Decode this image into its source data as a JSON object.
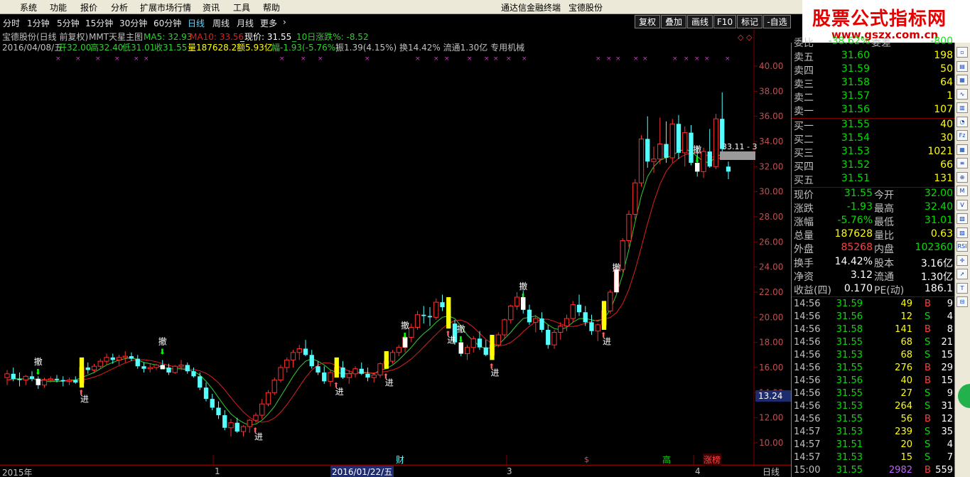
{
  "menubar": {
    "items": [
      "系统",
      "功能",
      "报价",
      "分析",
      "扩展市场行情",
      "资讯",
      "工具",
      "帮助"
    ],
    "app_title": "通达信金融终端",
    "stock_title": "宝德股份"
  },
  "periodbar": {
    "items": [
      "分时",
      "1分钟",
      "5分钟",
      "15分钟",
      "30分钟",
      "60分钟",
      "日线",
      "周线",
      "月线",
      "更多"
    ],
    "active": "日线",
    "more_arrow": "›"
  },
  "toolbar": {
    "buttons": [
      "复权",
      "叠加",
      "画线",
      "F10",
      "标记",
      "-自选"
    ]
  },
  "chart_header": {
    "line1_title": "宝德股份(日线 前复权)",
    "line1_formula": "MMT天星主图",
    "ma5_label": "MA5: 32.93",
    "ma10_label": "MA10: 33.56",
    "price_label": "_现价: 31.55",
    "chg10_label": "_10日涨跌%: -8.52",
    "line2_date": "2016/04/08/五",
    "line2_open": "开32.00",
    "line2_high": "高32.40",
    "line2_low": "低31.01",
    "line2_close": "收31.55",
    "line2_vol": "量187628.2",
    "line2_amount": "额5.93亿",
    "line2_chg": "幅-1.93(-5.76%)",
    "line2_rest": "振1.39(4.15%) 换14.42% 流通1.30亿 专用机械"
  },
  "y_axis": [
    "40.00",
    "38.00",
    "36.00",
    "34.00",
    "32.00",
    "30.00",
    "28.00",
    "26.00",
    "24.00",
    "22.00",
    "20.00",
    "18.00",
    "16.00",
    "14.00",
    "12.00",
    "10.00"
  ],
  "price_tag": "13.24",
  "price_tag_right": "33.11 - 3",
  "signal_labels": {
    "sell": "撤",
    "buy": "进"
  },
  "bottom_bar": {
    "year": "2015年",
    "m1": "1",
    "date_box": "2016/01/22/五",
    "m3": "3",
    "m4": "4",
    "cai": "财",
    "dollar": "$",
    "gao": "高",
    "zhangbang": "涨榜",
    "period": "日线"
  },
  "watermark": {
    "title": "股票公式指标网",
    "url": "www.gszx.com.cn"
  },
  "panel": {
    "weibi_label": "委比",
    "weibi_val": "-38.62%",
    "weicha_label": "委差",
    "weicha_val": "-800",
    "sells": [
      {
        "label": "卖五",
        "price": "31.60",
        "vol": "198"
      },
      {
        "label": "卖四",
        "price": "31.59",
        "vol": "50"
      },
      {
        "label": "卖三",
        "price": "31.58",
        "vol": "64"
      },
      {
        "label": "卖二",
        "price": "31.57",
        "vol": "1"
      },
      {
        "label": "卖一",
        "price": "31.56",
        "vol": "107"
      }
    ],
    "buys": [
      {
        "label": "买一",
        "price": "31.55",
        "vol": "40"
      },
      {
        "label": "买二",
        "price": "31.54",
        "vol": "30"
      },
      {
        "label": "买三",
        "price": "31.53",
        "vol": "1021"
      },
      {
        "label": "买四",
        "price": "31.52",
        "vol": "66"
      },
      {
        "label": "买五",
        "price": "31.51",
        "vol": "131"
      }
    ],
    "stats": [
      {
        "l1": "现价",
        "v1": "31.55",
        "c1": "green",
        "l2": "今开",
        "v2": "32.00",
        "c2": "green"
      },
      {
        "l1": "涨跌",
        "v1": "-1.93",
        "c1": "green",
        "l2": "最高",
        "v2": "32.40",
        "c2": "green"
      },
      {
        "l1": "涨幅",
        "v1": "-5.76%",
        "c1": "green",
        "l2": "最低",
        "v2": "31.01",
        "c2": "green"
      },
      {
        "l1": "总量",
        "v1": "187628",
        "c1": "yellow",
        "l2": "量比",
        "v2": "0.63",
        "c2": "yellow"
      },
      {
        "l1": "外盘",
        "v1": "85268",
        "c1": "red",
        "l2": "内盘",
        "v2": "102360",
        "c2": "green"
      },
      {
        "l1": "换手",
        "v1": "14.42%",
        "c1": "white",
        "l2": "股本",
        "v2": "3.16亿",
        "c2": "white"
      },
      {
        "l1": "净资",
        "v1": "3.12",
        "c1": "white",
        "l2": "流通",
        "v2": "1.30亿",
        "c2": "white"
      },
      {
        "l1": "收益(四)",
        "v1": "0.170",
        "c1": "white",
        "l2": "PE(动)",
        "v2": "186.1",
        "c2": "white"
      }
    ],
    "ticks": [
      {
        "t": "14:56",
        "p": "31.59",
        "v": "49",
        "bs": "B",
        "n": "9"
      },
      {
        "t": "14:56",
        "p": "31.56",
        "v": "12",
        "bs": "S",
        "n": "4"
      },
      {
        "t": "14:56",
        "p": "31.58",
        "v": "141",
        "bs": "B",
        "n": "8"
      },
      {
        "t": "14:56",
        "p": "31.55",
        "v": "68",
        "bs": "S",
        "n": "21"
      },
      {
        "t": "14:56",
        "p": "31.53",
        "v": "68",
        "bs": "S",
        "n": "15"
      },
      {
        "t": "14:56",
        "p": "31.55",
        "v": "276",
        "bs": "B",
        "n": "29"
      },
      {
        "t": "14:56",
        "p": "31.56",
        "v": "40",
        "bs": "B",
        "n": "15"
      },
      {
        "t": "14:56",
        "p": "31.55",
        "v": "27",
        "bs": "S",
        "n": "9"
      },
      {
        "t": "14:56",
        "p": "31.53",
        "v": "264",
        "bs": "S",
        "n": "31"
      },
      {
        "t": "14:56",
        "p": "31.55",
        "v": "56",
        "bs": "B",
        "n": "12"
      },
      {
        "t": "14:57",
        "p": "31.53",
        "v": "239",
        "bs": "S",
        "n": "35"
      },
      {
        "t": "14:57",
        "p": "31.51",
        "v": "20",
        "bs": "S",
        "n": "4"
      },
      {
        "t": "14:57",
        "p": "31.53",
        "v": "15",
        "bs": "S",
        "n": "7"
      },
      {
        "t": "15:00",
        "p": "31.55",
        "v": "2982",
        "bs": "B",
        "n": "559"
      }
    ]
  },
  "colors": {
    "up": "#ff3030",
    "down": "#54ffff",
    "ma5": "#32cd32",
    "ma10": "#dc2020",
    "signal_yellow": "#ffff00",
    "axis_red": "#800000"
  },
  "chart_data": {
    "type": "candlestick",
    "ylim": [
      10,
      40
    ],
    "ohlc": [
      [
        15.2,
        15.8,
        14.6,
        15.5
      ],
      [
        15.5,
        16.0,
        14.9,
        15.1
      ],
      [
        15.1,
        15.6,
        14.5,
        15.0
      ],
      [
        15.0,
        15.4,
        14.6,
        15.3
      ],
      [
        15.3,
        15.7,
        14.9,
        15.1
      ],
      [
        15.1,
        15.3,
        14.3,
        14.6
      ],
      [
        14.6,
        15.2,
        14.4,
        15.0
      ],
      [
        15.0,
        15.3,
        14.8,
        15.1
      ],
      [
        15.1,
        15.4,
        14.8,
        15.0
      ],
      [
        15.0,
        15.3,
        14.5,
        14.9
      ],
      [
        14.9,
        15.2,
        14.6,
        15.0
      ],
      [
        15.0,
        15.3,
        14.7,
        14.8
      ],
      [
        14.8,
        16.2,
        14.6,
        16.0
      ],
      [
        16.0,
        16.4,
        15.5,
        15.8
      ],
      [
        15.8,
        16.3,
        15.6,
        16.1
      ],
      [
        16.1,
        16.7,
        15.9,
        16.5
      ],
      [
        16.5,
        17.1,
        16.2,
        16.8
      ],
      [
        16.8,
        17.1,
        16.3,
        16.6
      ],
      [
        16.6,
        17.0,
        16.2,
        16.8
      ],
      [
        16.8,
        17.3,
        16.4,
        16.9
      ],
      [
        16.9,
        17.2,
        16.5,
        16.7
      ],
      [
        16.7,
        17.0,
        15.9,
        16.1
      ],
      [
        16.1,
        16.4,
        15.6,
        15.9
      ],
      [
        15.9,
        16.3,
        15.6,
        16.0
      ],
      [
        16.0,
        16.3,
        15.8,
        16.2
      ],
      [
        16.2,
        16.6,
        15.9,
        16.0
      ],
      [
        16.0,
        16.3,
        15.4,
        15.6
      ],
      [
        15.6,
        16.2,
        15.5,
        16.1
      ],
      [
        16.1,
        16.6,
        15.8,
        16.2
      ],
      [
        16.2,
        16.4,
        15.5,
        15.7
      ],
      [
        15.7,
        16.0,
        15.2,
        15.3
      ],
      [
        15.3,
        15.6,
        14.2,
        14.4
      ],
      [
        14.4,
        14.8,
        13.3,
        13.5
      ],
      [
        13.5,
        13.9,
        12.6,
        12.8
      ],
      [
        12.8,
        13.3,
        11.9,
        12.2
      ],
      [
        12.2,
        12.6,
        11.0,
        11.2
      ],
      [
        11.2,
        11.9,
        10.5,
        11.6
      ],
      [
        11.6,
        12.0,
        10.8,
        10.9
      ],
      [
        10.9,
        11.4,
        10.5,
        11.3
      ],
      [
        11.3,
        11.9,
        10.8,
        11.8
      ],
      [
        11.8,
        12.4,
        11.6,
        12.2
      ],
      [
        12.2,
        13.5,
        11.9,
        13.1
      ],
      [
        13.1,
        14.2,
        12.9,
        14.0
      ],
      [
        14.0,
        15.2,
        13.8,
        15.0
      ],
      [
        15.0,
        16.2,
        14.8,
        16.0
      ],
      [
        16.0,
        16.8,
        15.6,
        16.6
      ],
      [
        16.6,
        17.4,
        16.0,
        17.2
      ],
      [
        17.2,
        17.8,
        16.6,
        17.5
      ],
      [
        17.5,
        18.2,
        16.9,
        17.0
      ],
      [
        17.0,
        17.4,
        15.9,
        16.1
      ],
      [
        16.1,
        16.5,
        15.4,
        15.6
      ],
      [
        15.6,
        16.1,
        14.7,
        14.9
      ],
      [
        14.9,
        15.8,
        14.5,
        15.6
      ],
      [
        15.6,
        16.1,
        15.2,
        16.0
      ],
      [
        16.0,
        16.5,
        15.1,
        15.2
      ],
      [
        15.2,
        15.8,
        14.7,
        15.5
      ],
      [
        15.5,
        16.1,
        15.2,
        15.9
      ],
      [
        15.9,
        16.4,
        15.4,
        15.5
      ],
      [
        15.5,
        16.0,
        14.9,
        15.2
      ],
      [
        15.2,
        15.6,
        14.8,
        15.4
      ],
      [
        15.4,
        16.4,
        15.2,
        16.3
      ],
      [
        16.3,
        16.8,
        15.9,
        16.5
      ],
      [
        16.5,
        17.4,
        16.3,
        17.2
      ],
      [
        17.2,
        17.8,
        16.9,
        17.6
      ],
      [
        17.6,
        18.5,
        17.2,
        18.4
      ],
      [
        18.4,
        19.5,
        18.0,
        19.2
      ],
      [
        19.2,
        20.5,
        19.0,
        20.2
      ],
      [
        20.2,
        20.9,
        19.5,
        20.1
      ],
      [
        20.1,
        20.8,
        19.3,
        20.0
      ],
      [
        20.0,
        21.5,
        19.8,
        21.2
      ],
      [
        21.2,
        21.8,
        20.5,
        20.8
      ],
      [
        20.8,
        21.1,
        19.3,
        19.5
      ],
      [
        19.5,
        19.8,
        17.8,
        18.0
      ],
      [
        18.0,
        18.5,
        16.9,
        17.1
      ],
      [
        17.1,
        17.8,
        16.6,
        17.6
      ],
      [
        17.6,
        18.5,
        17.2,
        18.3
      ],
      [
        18.3,
        18.9,
        17.4,
        17.6
      ],
      [
        17.6,
        18.2,
        16.9,
        17.0
      ],
      [
        17.0,
        17.9,
        16.7,
        17.8
      ],
      [
        17.8,
        18.8,
        17.6,
        18.6
      ],
      [
        18.6,
        19.9,
        18.3,
        19.8
      ],
      [
        19.8,
        21.0,
        19.5,
        20.9
      ],
      [
        20.9,
        22.0,
        20.6,
        21.6
      ],
      [
        21.6,
        22.1,
        20.3,
        20.6
      ],
      [
        20.6,
        21.0,
        19.4,
        19.6
      ],
      [
        19.6,
        20.2,
        18.8,
        19.9
      ],
      [
        19.9,
        20.4,
        18.8,
        19.0
      ],
      [
        19.0,
        19.4,
        17.5,
        17.8
      ],
      [
        17.8,
        19.0,
        17.5,
        18.8
      ],
      [
        18.8,
        19.6,
        18.2,
        19.3
      ],
      [
        19.3,
        20.2,
        18.9,
        19.9
      ],
      [
        19.9,
        21.3,
        19.6,
        21.0
      ],
      [
        21.0,
        21.8,
        20.1,
        20.4
      ],
      [
        20.4,
        20.9,
        19.3,
        19.6
      ],
      [
        19.6,
        20.2,
        18.6,
        18.9
      ],
      [
        18.9,
        19.5,
        18.1,
        19.4
      ],
      [
        19.4,
        20.6,
        19.2,
        20.5
      ],
      [
        20.5,
        22.2,
        20.3,
        22.0
      ],
      [
        22.0,
        24.1,
        21.8,
        23.8
      ],
      [
        23.8,
        26.3,
        23.6,
        26.1
      ],
      [
        26.1,
        28.5,
        25.6,
        28.2
      ],
      [
        28.2,
        31.0,
        27.8,
        30.7
      ],
      [
        30.7,
        34.5,
        30.4,
        34.2
      ],
      [
        34.2,
        36.0,
        31.9,
        32.4
      ],
      [
        32.4,
        33.6,
        31.5,
        32.6
      ],
      [
        32.6,
        35.9,
        32.2,
        33.8
      ],
      [
        33.8,
        35.6,
        32.3,
        32.7
      ],
      [
        32.7,
        35.8,
        32.3,
        35.4
      ],
      [
        35.4,
        36.1,
        32.6,
        33.1
      ],
      [
        33.1,
        35.2,
        32.0,
        34.7
      ],
      [
        34.7,
        35.3,
        32.1,
        32.3
      ],
      [
        32.3,
        33.6,
        31.2,
        31.6
      ],
      [
        31.6,
        33.5,
        31.1,
        33.2
      ],
      [
        33.2,
        35.0,
        31.9,
        32.0
      ],
      [
        32.0,
        36.2,
        31.8,
        35.8
      ],
      [
        35.8,
        37.9,
        33.2,
        33.4
      ],
      [
        32.0,
        32.4,
        31.0,
        31.6
      ]
    ],
    "ma5": [
      15.0,
      15.1,
      15.1,
      15.1,
      15.1,
      15.0,
      14.9,
      14.9,
      14.9,
      14.9,
      15.0,
      15.0,
      15.2,
      15.4,
      15.6,
      15.9,
      16.2,
      16.4,
      16.6,
      16.7,
      16.8,
      16.6,
      16.4,
      16.3,
      16.2,
      16.0,
      15.9,
      15.9,
      15.9,
      15.8,
      15.7,
      15.4,
      14.9,
      14.3,
      13.6,
      12.9,
      12.3,
      11.9,
      11.6,
      11.4,
      11.5,
      11.8,
      12.3,
      12.9,
      13.7,
      14.5,
      15.3,
      16.0,
      16.5,
      16.7,
      16.5,
      16.2,
      15.8,
      15.6,
      15.5,
      15.5,
      15.6,
      15.6,
      15.6,
      15.5,
      15.8,
      15.9,
      16.2,
      16.6,
      17.1,
      17.6,
      18.2,
      18.7,
      19.1,
      19.6,
      20.0,
      20.1,
      19.9,
      19.3,
      18.6,
      18.1,
      17.7,
      17.5,
      17.6,
      17.8,
      18.3,
      18.8,
      19.4,
      19.9,
      20.0,
      20.1,
      19.8,
      19.4,
      19.1,
      19.0,
      19.2,
      19.6,
      19.9,
      19.9,
      19.8,
      19.7,
      19.9,
      20.6,
      21.8,
      23.4,
      25.4,
      27.6,
      29.7,
      31.2,
      32.0,
      32.5,
      32.7,
      32.9,
      33.2,
      33.4,
      33.2,
      32.8,
      32.4,
      32.3,
      32.8,
      33.0,
      32.9
    ]
  }
}
